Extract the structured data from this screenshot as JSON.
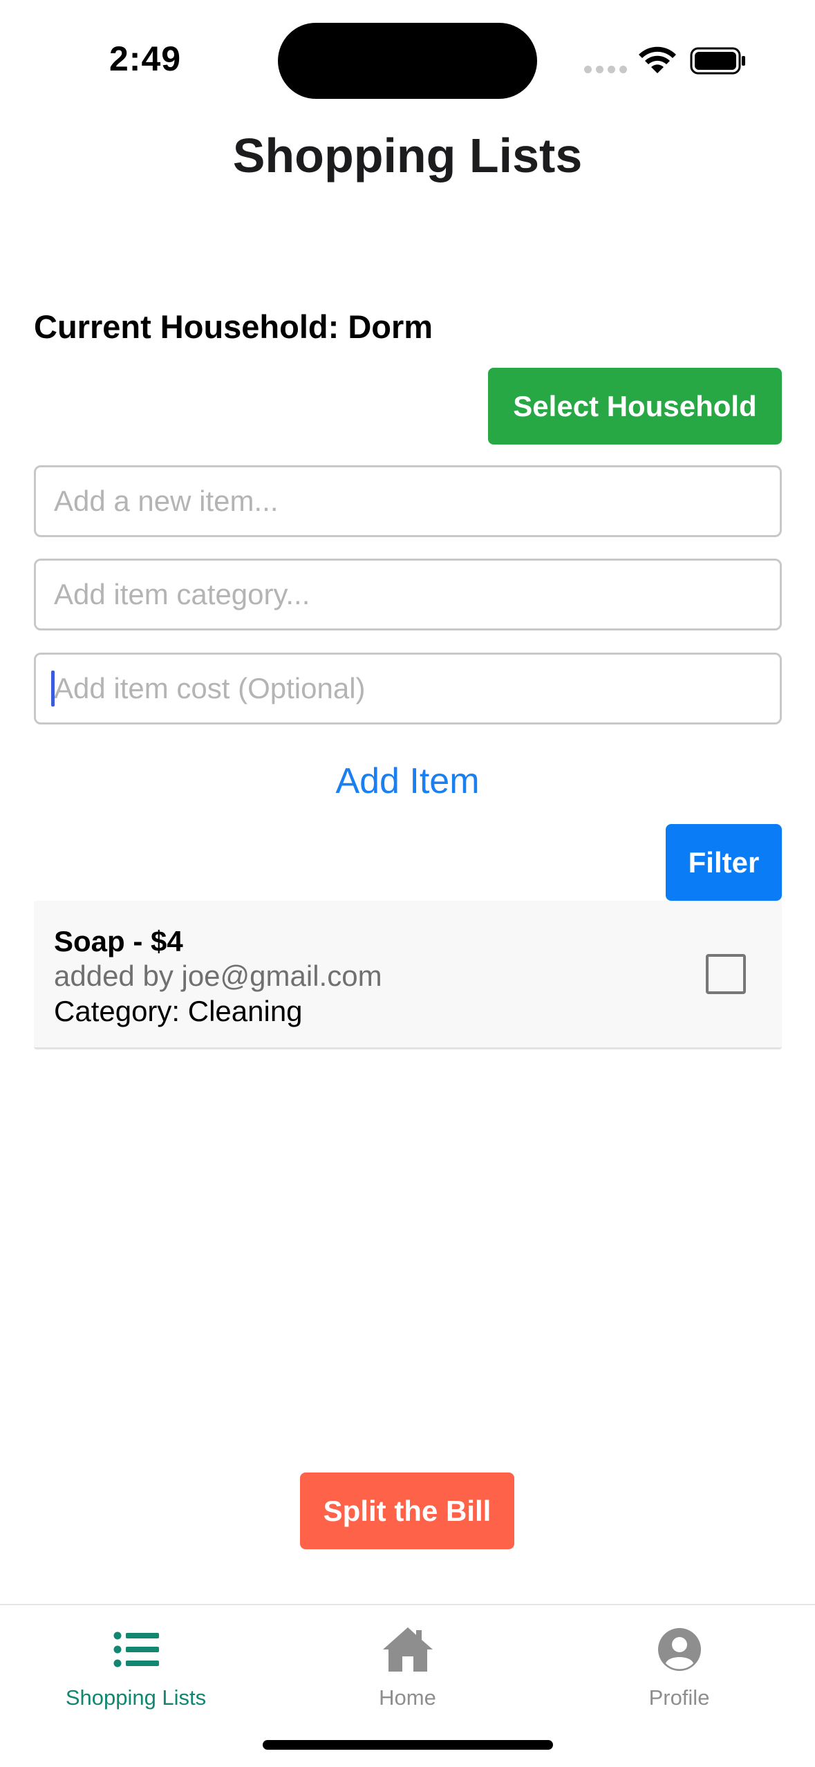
{
  "status_bar": {
    "time": "2:49"
  },
  "header": {
    "title": "Shopping Lists"
  },
  "household": {
    "label": "Current Household: Dorm",
    "select_button": "Select Household"
  },
  "form": {
    "item_placeholder": "Add a new item...",
    "category_placeholder": "Add item category...",
    "cost_placeholder": "Add item cost (Optional)",
    "add_button": "Add Item"
  },
  "filter_button": "Filter",
  "items": [
    {
      "title": "Soap - $4",
      "added_by": "added by joe@gmail.com",
      "category": "Category: Cleaning",
      "checked": false
    }
  ],
  "split_button": "Split the Bill",
  "tabs": [
    {
      "label": "Shopping Lists",
      "icon": "list-icon",
      "active": true
    },
    {
      "label": "Home",
      "icon": "home-icon",
      "active": false
    },
    {
      "label": "Profile",
      "icon": "profile-icon",
      "active": false
    }
  ],
  "colors": {
    "select_household": "#28a745",
    "filter": "#0a7cf5",
    "split_bill": "#fe634a",
    "active_tab": "#138671",
    "link": "#1a7ff0"
  }
}
